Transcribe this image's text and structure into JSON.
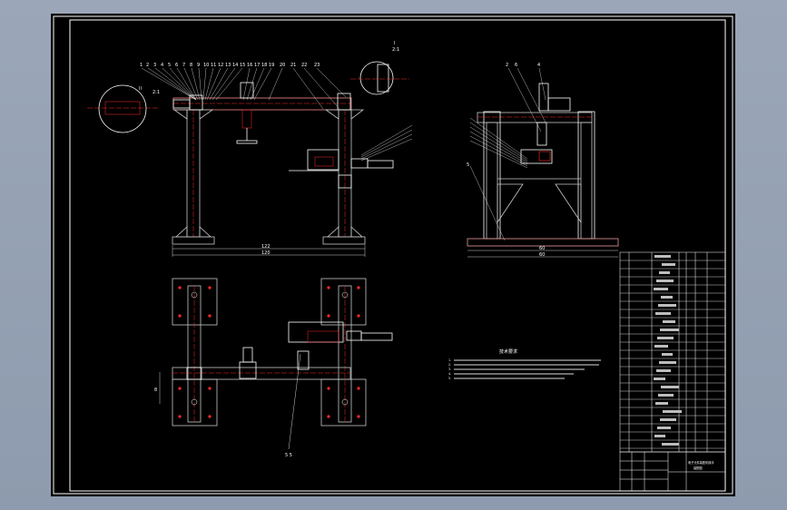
{
  "drawing": {
    "background_color": "#000000",
    "frame_color": "#ffffff",
    "accent_color": "#ff2a2a",
    "part_color": "#c8c8c8",
    "view_a_dim_inner": "122",
    "view_a_dim_outer": "120",
    "view_b_dim_inner": "60",
    "view_b_dim_outer": "60",
    "view_c_dim_vertical": "8",
    "view_c_leader_label": "5 5",
    "detail_left_label": "II",
    "detail_left_sublabel": "2:1",
    "detail_top_label": "I",
    "detail_top_sublabel": "2:1",
    "view_a_balloons": [
      "1",
      "2",
      "3",
      "4",
      "5",
      "6",
      "7",
      "8",
      "9",
      "10",
      "11",
      "12",
      "13",
      "14",
      "15",
      "16",
      "17",
      "18",
      "19",
      "20",
      "21",
      "22",
      "23"
    ],
    "view_b_balloons": [
      "2",
      "6",
      "4",
      "5"
    ],
    "notes_title": "技术要求",
    "notes_lines": [
      "1.",
      "2.",
      "3.",
      "4.",
      "5."
    ],
    "title_block_text": "电子元件装配机械手",
    "title_block_sub": "装配图"
  }
}
